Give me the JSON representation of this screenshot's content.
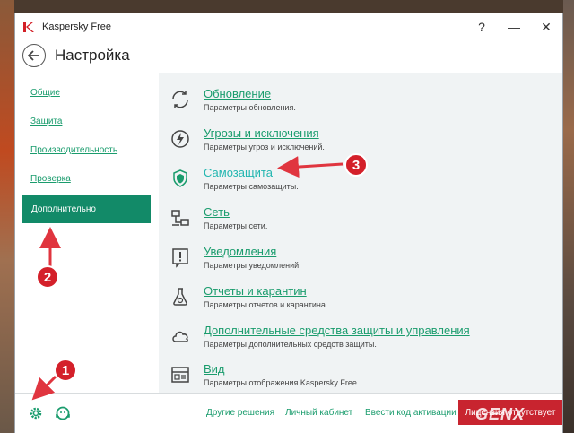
{
  "window": {
    "app_title": "Kaspersky Free",
    "help_label": "?",
    "minimize_label": "—",
    "close_label": "✕"
  },
  "header": {
    "title": "Настройка"
  },
  "sidebar": {
    "items": [
      {
        "label": "Общие"
      },
      {
        "label": "Защита"
      },
      {
        "label": "Производительность"
      },
      {
        "label": "Проверка"
      },
      {
        "label": "Дополнительно",
        "active": true
      }
    ]
  },
  "settings": [
    {
      "title": "Обновление",
      "desc": "Параметры обновления.",
      "icon": "refresh-icon"
    },
    {
      "title": "Угрозы и исключения",
      "desc": "Параметры угроз и исключений.",
      "icon": "lightning-icon"
    },
    {
      "title": "Самозащита",
      "desc": "Параметры самозащиты.",
      "icon": "shield-icon"
    },
    {
      "title": "Сеть",
      "desc": "Параметры сети.",
      "icon": "network-icon"
    },
    {
      "title": "Уведомления",
      "desc": "Параметры уведомлений.",
      "icon": "alert-icon"
    },
    {
      "title": "Отчеты и карантин",
      "desc": "Параметры отчетов и карантина.",
      "icon": "flask-icon"
    },
    {
      "title": "Дополнительные средства защиты и управления",
      "desc": "Параметры дополнительных средств защиты.",
      "icon": "cloud-icon"
    },
    {
      "title": "Вид",
      "desc": "Параметры отображения Kaspersky Free.",
      "icon": "display-icon"
    }
  ],
  "footer": {
    "links": [
      "Другие решения",
      "Личный кабинет",
      "Ввести код активации"
    ],
    "license_label": "Лицензия отсутствует"
  },
  "annotations": [
    "1",
    "2",
    "3"
  ],
  "watermark": "GENX",
  "colors": {
    "accent": "#1a9c6d",
    "active_nav": "#128a68",
    "license": "#c8242f",
    "marker": "#d4202a"
  }
}
